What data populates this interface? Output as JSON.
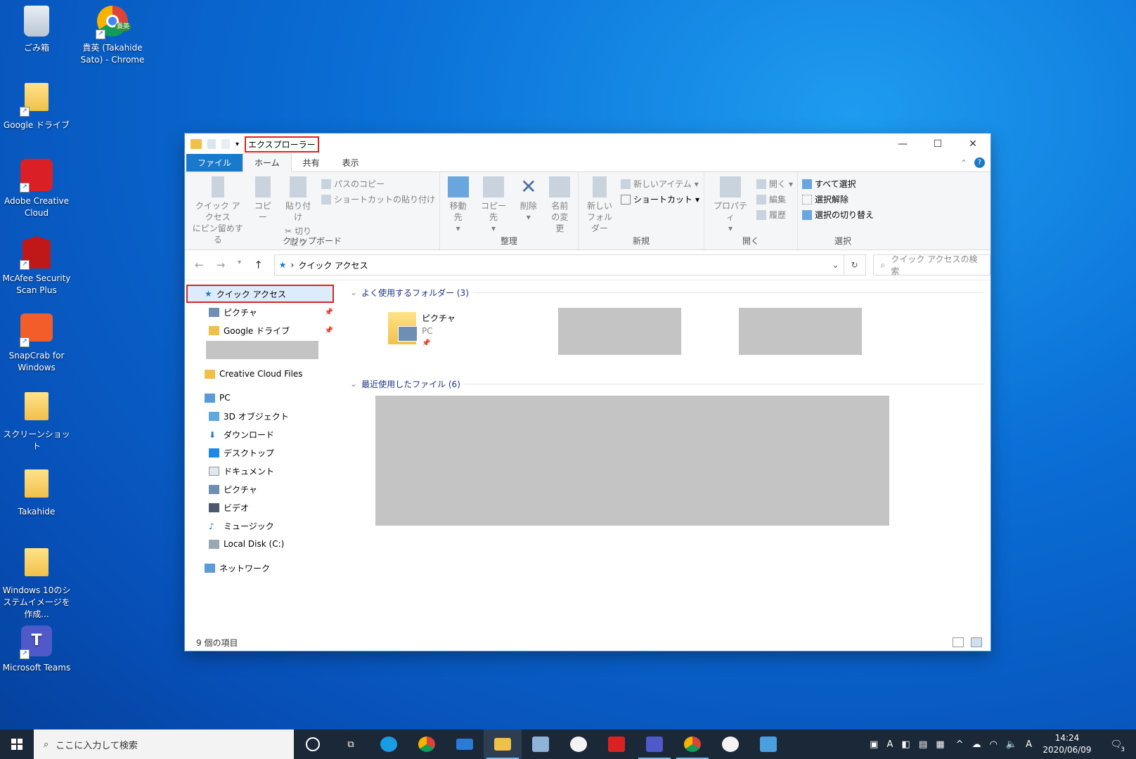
{
  "desktop_icons": [
    {
      "label": "ごみ箱"
    },
    {
      "label": "貴英 (Takahide Sato) - Chrome"
    },
    {
      "label": "Google ドライブ"
    },
    {
      "label": "Adobe Creative Cloud"
    },
    {
      "label": "McAfee Security Scan Plus"
    },
    {
      "label": "SnapCrab for Windows"
    },
    {
      "label": "スクリーンショット"
    },
    {
      "label": "Takahide"
    },
    {
      "label": "Windows 10のシステムイメージを作成..."
    },
    {
      "label": "Microsoft Teams"
    }
  ],
  "chrome_badge": "貴英",
  "window": {
    "title": "エクスプローラー",
    "tabs": {
      "file": "ファイル",
      "home": "ホーム",
      "share": "共有",
      "view": "表示"
    },
    "ribbon": {
      "clipboard": {
        "name": "クリップボード",
        "pin": "クイック アクセス\nにピン留めする",
        "pin1": "クイック アクセス",
        "pin2": "にピン留めする",
        "copy": "コピー",
        "paste": "貼り付け",
        "copy_path": "パスのコピー",
        "paste_shortcut": "ショートカットの貼り付け",
        "cut": "切り取り"
      },
      "organize": {
        "name": "整理",
        "move": "移動先",
        "copyto": "コピー先",
        "delete": "削除",
        "rename1": "名前",
        "rename2": "の変更"
      },
      "new": {
        "name": "新規",
        "folder1": "新しい",
        "folder2": "フォルダー",
        "item": "新しいアイテム",
        "shortcut": "ショートカット"
      },
      "open": {
        "name": "開く",
        "props": "プロパティ",
        "open": "開く",
        "edit": "編集",
        "history": "履歴"
      },
      "select": {
        "name": "選択",
        "all": "すべて選択",
        "none": "選択解除",
        "invert": "選択の切り替え"
      }
    },
    "address": {
      "path": "クイック アクセス",
      "search_placeholder": "クイック アクセスの検索"
    },
    "nav": {
      "quick_access": "クイック アクセス",
      "pictures": "ピクチャ",
      "google_drive": "Google ドライブ",
      "creative_cloud": "Creative Cloud Files",
      "pc": "PC",
      "objects3d": "3D オブジェクト",
      "downloads": "ダウンロード",
      "desktop": "デスクトップ",
      "documents": "ドキュメント",
      "pictures2": "ピクチャ",
      "videos": "ビデオ",
      "music": "ミュージック",
      "local_disk": "Local Disk (C:)",
      "network": "ネットワーク"
    },
    "content": {
      "frequent_header": "よく使用するフォルダー (3)",
      "recent_header": "最近使用したファイル (6)",
      "folder_name": "ピクチャ",
      "folder_loc": "PC"
    },
    "status": "9 個の項目"
  },
  "taskbar": {
    "search_placeholder": "ここに入力して検索",
    "time": "14:24",
    "date": "2020/06/09",
    "ime": "A",
    "notifications": "3"
  }
}
